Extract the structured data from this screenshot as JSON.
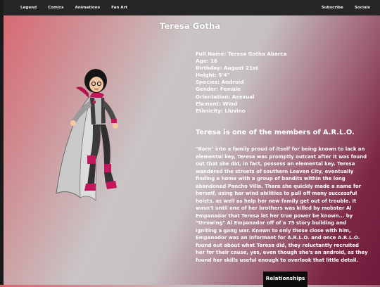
{
  "nav": {
    "left": [
      "Legend",
      "Comics",
      "Animations",
      "Fan Art"
    ],
    "right": [
      "Subscribe",
      "Socials"
    ]
  },
  "title": "Teresa Gotha",
  "info": [
    "Full Name: Teresa Gotha Abarca",
    "Age: 16",
    "Birthday: August 21st",
    "Height: 5'4\"",
    "Species: Android",
    "Gender: Female",
    "Orientation: Asexual",
    "Element: Wind",
    "Ethnicity: Lluvino"
  ],
  "heading": "Teresa is one of the members of A.R.L.O.",
  "bio": "\"Born\" into a family proud of itself for being known to lack an elemental key, Teresa was promptly outcast after it was found out that she did, in fact, possess an elemental key. Teresa wandered the streets of southern Leaven City, eventually finding a home with a group of bandits within the long abandoned Pancho Villa. There she quickly made a name for herself, using her wind abilities to pull off many successful heists, as well as help her new family get out of trouble. It wasn't until one of her brothers was killed by mobster Al Empanador that Teresa let her true power be known... by \"throwing\" Al Empanador off of a 75 story building and igniting a gang war. Known to only those close with him, Empanador was an informant for A.R.L.O. and once A.R.L.O. found out about what Teresa did, they reluctantly recruited her for their cause, yes, even though she's an android, as they found her skills useful enough to overlook that little detail.",
  "relationships_label": "Relationships",
  "colors": {
    "navbar": "#262626",
    "text": "#ffffff",
    "button": "#0d0d0d",
    "accent": "#c2185b"
  }
}
